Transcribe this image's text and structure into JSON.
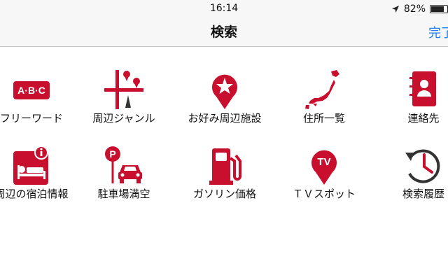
{
  "status_bar": {
    "time": "16:14",
    "battery_text": "82%",
    "battery_level": 0.82
  },
  "nav": {
    "title": "検索",
    "done_label": "完了"
  },
  "accent_color": "#c8102e",
  "items": [
    {
      "label": "フリーワード",
      "icon": "abc-keyboard-icon"
    },
    {
      "label": "周辺ジャンル",
      "icon": "nearby-genre-map-icon"
    },
    {
      "label": "お好み周辺施設",
      "icon": "favorite-pin-star-icon"
    },
    {
      "label": "住所一覧",
      "icon": "japan-map-icon"
    },
    {
      "label": "連絡先",
      "icon": "contacts-book-icon"
    },
    {
      "label": "周辺の宿泊情報",
      "icon": "hotel-bed-icon"
    },
    {
      "label": "駐車場満空",
      "icon": "parking-car-icon"
    },
    {
      "label": "ガソリン価格",
      "icon": "gas-pump-icon"
    },
    {
      "label": "ＴＶスポット",
      "icon": "tv-pin-icon"
    },
    {
      "label": "検索履歴",
      "icon": "history-clock-icon"
    }
  ]
}
